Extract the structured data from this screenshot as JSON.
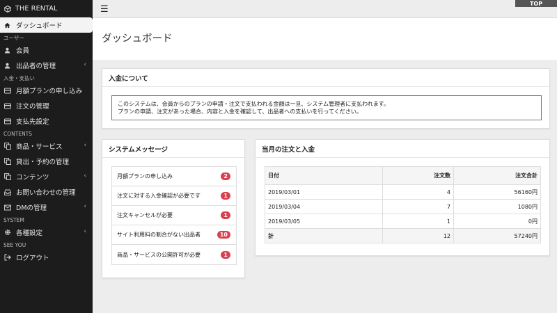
{
  "brand": {
    "name": "THE RENTAL",
    "logo_icon": "cube-icon"
  },
  "sidebar": {
    "items": [
      {
        "type": "item",
        "label": "ダッシュボード",
        "icon": "home-icon",
        "active": true
      },
      {
        "type": "section",
        "label": "ユーザー"
      },
      {
        "type": "item",
        "label": "会員",
        "icon": "user-icon"
      },
      {
        "type": "item",
        "label": "出品者の管理",
        "icon": "user-icon",
        "chevron": true
      },
      {
        "type": "section",
        "label": "入金・支払い"
      },
      {
        "type": "item",
        "label": "月額プランの申し込み",
        "icon": "card-icon"
      },
      {
        "type": "item",
        "label": "注文の管理",
        "icon": "card-icon"
      },
      {
        "type": "item",
        "label": "支払先設定",
        "icon": "card-icon"
      },
      {
        "type": "section",
        "label": "CONTENTS"
      },
      {
        "type": "item",
        "label": "商品・サービス",
        "icon": "copy-icon",
        "chevron": true
      },
      {
        "type": "item",
        "label": "貸出・予約の管理",
        "icon": "copy-icon"
      },
      {
        "type": "item",
        "label": "コンテンツ",
        "icon": "copy-icon",
        "chevron": true
      },
      {
        "type": "item",
        "label": "お問い合わせの管理",
        "icon": "inbox-icon"
      },
      {
        "type": "item",
        "label": "DMの管理",
        "icon": "mail-icon",
        "chevron": true
      },
      {
        "type": "section",
        "label": "SYSTEM"
      },
      {
        "type": "item",
        "label": "各種設定",
        "icon": "gear-icon",
        "chevron": true
      },
      {
        "type": "section",
        "label": "SEE YOU"
      },
      {
        "type": "item",
        "label": "ログアウト",
        "icon": "logout-icon"
      }
    ]
  },
  "topbar": {
    "menu_icon": "hamburger-icon",
    "top_label": "TOP"
  },
  "page": {
    "title": "ダッシュボード"
  },
  "about": {
    "title": "入金について",
    "lines": [
      "このシステムは、会員からのプランの申請・注文で支払われる金額は一旦、システム管理者に支払われます。",
      "プランの申請、注文があった場合、内容と入金を確認して、出品者への支払いを行ってください。"
    ]
  },
  "system_messages": {
    "title": "システムメッセージ",
    "items": [
      {
        "label": "月額プランの申し込み",
        "count": "2"
      },
      {
        "label": "注文に対する入金確認が必要です",
        "count": "1"
      },
      {
        "label": "注文キャンセルが必要",
        "count": "1"
      },
      {
        "label": "サイト利用料の割合がない出品者",
        "count": "10"
      },
      {
        "label": "商品・サービスの公開許可が必要",
        "count": "1"
      }
    ]
  },
  "orders": {
    "title": "当月の注文と入金",
    "headers": [
      "日付",
      "注文数",
      "注文合計"
    ],
    "rows": [
      [
        "2019/03/01",
        "4",
        "56160円"
      ],
      [
        "2019/03/04",
        "7",
        "1080円"
      ],
      [
        "2019/03/05",
        "1",
        "0円"
      ]
    ],
    "total": [
      "計",
      "12",
      "57240円"
    ]
  },
  "colors": {
    "sidebar_bg": "#1c1c1c",
    "badge": "#d9414f",
    "page_bg": "#ededed"
  }
}
